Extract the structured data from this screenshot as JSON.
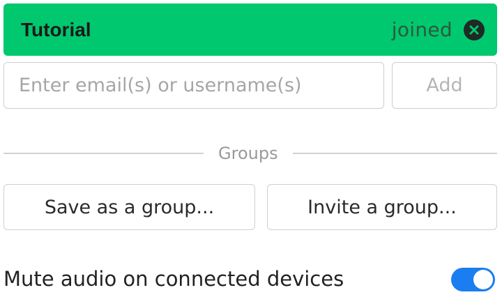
{
  "member": {
    "name": "Tutorial",
    "status": "joined",
    "remove_icon": "close-circle-icon",
    "row_color": "#00c86f"
  },
  "invite": {
    "placeholder": "Enter email(s) or username(s)",
    "value": "",
    "add_label": "Add"
  },
  "groups": {
    "divider_label": "Groups",
    "save_label": "Save as a group...",
    "invite_label": "Invite a group..."
  },
  "settings": {
    "mute_label": "Mute audio on connected devices",
    "mute_enabled": true,
    "toggle_color": "#1a7ef0"
  }
}
